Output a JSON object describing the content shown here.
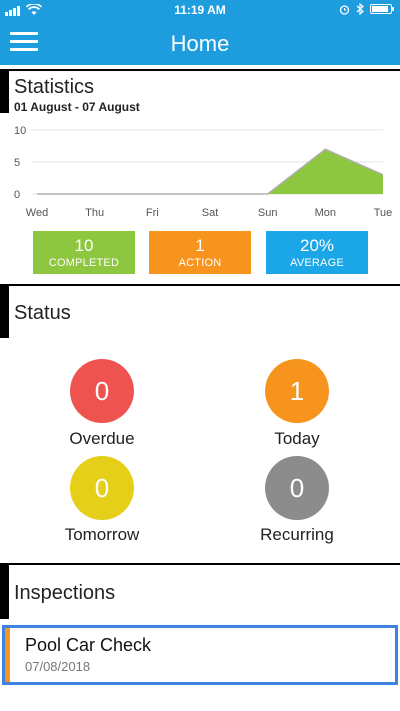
{
  "status_bar": {
    "time": "11:19 AM"
  },
  "header": {
    "title": "Home",
    "menu_icon": "hamburger-menu-icon"
  },
  "statistics": {
    "title": "Statistics",
    "date_range": "01 August - 07 August",
    "chart_data": {
      "type": "area",
      "categories": [
        "Wed",
        "Thu",
        "Fri",
        "Sat",
        "Sun",
        "Mon",
        "Tue"
      ],
      "values": [
        0,
        0,
        0,
        0,
        0,
        7,
        3
      ],
      "ylim": [
        0,
        10
      ],
      "yticks": [
        0,
        5,
        10
      ],
      "grid": true,
      "fill_color": "#8dc63f",
      "line_color": "#b0b0b0"
    },
    "tiles": [
      {
        "value": "10",
        "label": "COMPLETED",
        "color": "#8dc63f"
      },
      {
        "value": "1",
        "label": "ACTION",
        "color": "#f7941d"
      },
      {
        "value": "20%",
        "label": "AVERAGE",
        "color": "#1ba6e8"
      }
    ]
  },
  "status": {
    "title": "Status",
    "items": [
      {
        "count": "0",
        "label": "Overdue",
        "color": "#ef5350"
      },
      {
        "count": "1",
        "label": "Today",
        "color": "#f7941d"
      },
      {
        "count": "0",
        "label": "Tomorrow",
        "color": "#e5cf18"
      },
      {
        "count": "0",
        "label": "Recurring",
        "color": "#8c8c8c"
      }
    ]
  },
  "inspections": {
    "title": "Inspections",
    "items": [
      {
        "name": "Pool Car Check",
        "date": "07/08/2018",
        "accent": "#f39425"
      }
    ]
  },
  "colors": {
    "brand": "#1d9ddd",
    "selected_border": "#3f83e0"
  }
}
